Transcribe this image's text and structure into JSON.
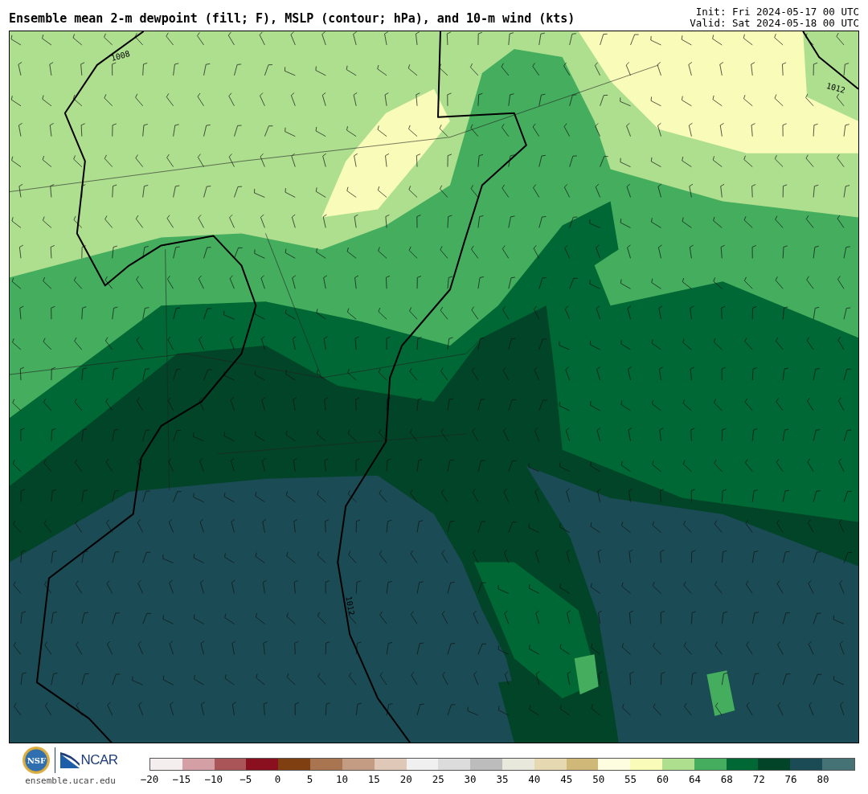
{
  "header": {
    "title": "Ensemble mean 2-m dewpoint (fill; F), MSLP (contour; hPa), and 10-m wind (kts)",
    "init": "Init: Fri 2024-05-17 00 UTC",
    "valid": "Valid: Sat 2024-05-18 00 UTC"
  },
  "map": {
    "contour_labels": [
      {
        "text": "1008"
      },
      {
        "text": "1012"
      },
      {
        "text": "1012"
      }
    ]
  },
  "footer": {
    "logo_emblem": "NSF",
    "logo_name": "NCAR",
    "url": "ensemble.ucar.edu"
  },
  "colorbar": {
    "segments": [
      {
        "color": "#f5eeee"
      },
      {
        "color": "#d4a0a5"
      },
      {
        "color": "#aa5558"
      },
      {
        "color": "#8a1020"
      },
      {
        "color": "#7f3f10"
      },
      {
        "color": "#a87550"
      },
      {
        "color": "#c49c84"
      },
      {
        "color": "#e0c8b8"
      },
      {
        "color": "#f0f0f0"
      },
      {
        "color": "#dcdcdc"
      },
      {
        "color": "#bcbcbc"
      },
      {
        "color": "#e8e8dc"
      },
      {
        "color": "#e6d8b0"
      },
      {
        "color": "#d0b878"
      },
      {
        "color": "#fffde0"
      },
      {
        "color": "#f8fcb8"
      },
      {
        "color": "#addf8f"
      },
      {
        "color": "#44ad5e"
      },
      {
        "color": "#006834"
      },
      {
        "color": "#024428"
      },
      {
        "color": "#1b4b55"
      },
      {
        "color": "#457375"
      }
    ],
    "ticks": [
      "−20",
      "−15",
      "−10",
      "−5",
      "0",
      "5",
      "10",
      "15",
      "20",
      "25",
      "30",
      "35",
      "40",
      "45",
      "50",
      "55",
      "60",
      "64",
      "68",
      "72",
      "76",
      "80"
    ]
  }
}
